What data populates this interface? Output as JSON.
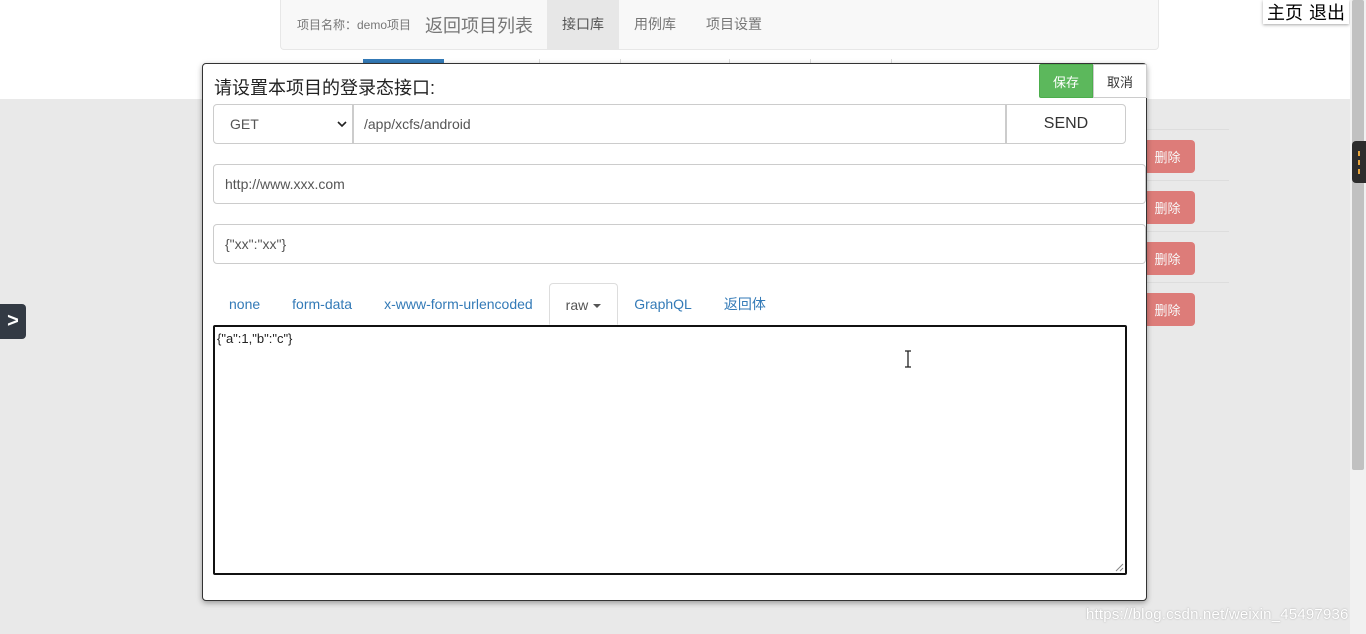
{
  "top_nav": {
    "project_label": "项目名称：demo项目",
    "back_link": "返回项目列表",
    "items": [
      {
        "label": "接口库",
        "active": true
      },
      {
        "label": "用例库",
        "active": false
      },
      {
        "label": "项目设置",
        "active": false
      }
    ]
  },
  "top_right": {
    "home_label": "主页",
    "logout_label": "退出"
  },
  "side_toggle_label": ">",
  "bg_rows": {
    "delete_label": "删除",
    "count": 4
  },
  "modal": {
    "title": "请设置本项目的登录态接口:",
    "save_label": "保存",
    "cancel_label": "取消",
    "method": "GET",
    "url_value": "/app/xcfs/android",
    "send_label": "SEND",
    "host_value": "http://www.xxx.com",
    "headers_value": "{\"xx\":\"xx\"}",
    "body_tabs": [
      {
        "label": "none",
        "active": false
      },
      {
        "label": "form-data",
        "active": false
      },
      {
        "label": "x-www-form-urlencoded",
        "active": false
      },
      {
        "label": "raw",
        "active": true
      },
      {
        "label": "GraphQL",
        "active": false
      },
      {
        "label": "返回体",
        "active": false
      }
    ],
    "raw_body": "{\"a\":1,\"b\":\"c\"}"
  },
  "watermark": "https://blog.csdn.net/weixin_45497936",
  "colors": {
    "save_green": "#5cb85c",
    "delete_red": "#d9534f",
    "link_blue": "#337ab7"
  }
}
